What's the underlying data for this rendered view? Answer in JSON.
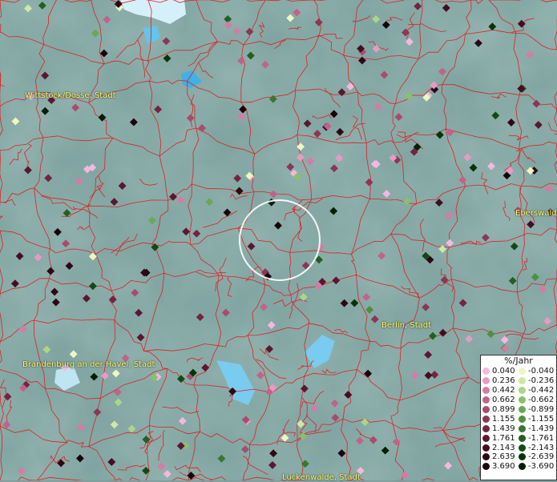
{
  "map": {
    "boundary_color": "#dd2222",
    "town_labels": [
      {
        "name": "Wittstock/Dosse, Stadt"
      },
      {
        "name": "Eberswalde"
      },
      {
        "name": "Berlin, Stadt"
      },
      {
        "name": "Brandenburg an der Havel, Stadt"
      },
      {
        "name": "Luckenwalde, Stadt"
      }
    ]
  },
  "legend": {
    "title": "%/Jahr",
    "positive": [
      {
        "label": "0.040",
        "color": "#f4b8de"
      },
      {
        "label": "0.236",
        "color": "#e89ac4"
      },
      {
        "label": "0.442",
        "color": "#d67aa6"
      },
      {
        "label": "0.662",
        "color": "#c2628a"
      },
      {
        "label": "0.899",
        "color": "#a84c6e"
      },
      {
        "label": "1.155",
        "color": "#8c3656"
      },
      {
        "label": "1.439",
        "color": "#742440"
      },
      {
        "label": "1.761",
        "color": "#5c1630"
      },
      {
        "label": "2.143",
        "color": "#450c22"
      },
      {
        "label": "2.639",
        "color": "#300616"
      },
      {
        "label": "3.690",
        "color": "#1a020a"
      }
    ],
    "negative": [
      {
        "label": "-0.040",
        "color": "#eef6c2"
      },
      {
        "label": "-0.236",
        "color": "#cfe8a4"
      },
      {
        "label": "-0.442",
        "color": "#acd686"
      },
      {
        "label": "-0.662",
        "color": "#8ac06a"
      },
      {
        "label": "-0.899",
        "color": "#6aa852"
      },
      {
        "label": "-1.155",
        "color": "#4e903e"
      },
      {
        "label": "-1.439",
        "color": "#36782e"
      },
      {
        "label": "-1.761",
        "color": "#226020"
      },
      {
        "label": "-2.143",
        "color": "#124a14"
      },
      {
        "label": "-2.639",
        "color": "#06340a"
      },
      {
        "label": "-3.690",
        "color": "#002004"
      }
    ]
  }
}
